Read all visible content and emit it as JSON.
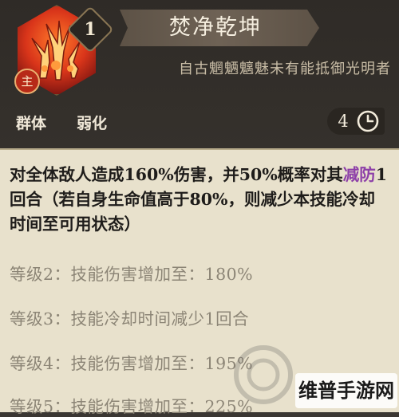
{
  "skill": {
    "level": "1",
    "main_tag": "主",
    "name": "焚净乾坤",
    "quote": "自古魍魉魑魅未有能抵御光明者",
    "tags": [
      "群体",
      "弱化"
    ],
    "cooldown": "4",
    "icon": "flame-icon"
  },
  "description": {
    "part1": "对全体敌人造成160%伤害，并50%概率对其",
    "highlight": "减防",
    "part2": "1回合（若自身生命值高于80%，则减少本技能冷却时间至可用状态）",
    "highlight_color": "#8d3fa8"
  },
  "levels": [
    "等级2：技能伤害增加至：180%",
    "等级3：技能冷却时间减少1回合",
    "等级4：技能伤害增加至：195%",
    "等级5：技能伤害增加至：225%"
  ],
  "watermark": {
    "text": "维普手游网"
  },
  "colors": {
    "panel": "#e8e1cc",
    "header": "#35312c",
    "accent": "#8d3fa8"
  }
}
